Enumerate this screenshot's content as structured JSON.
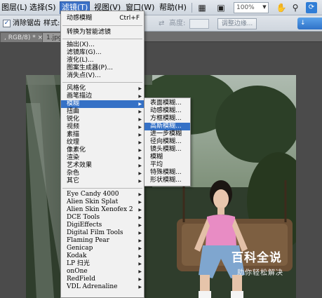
{
  "menubar": {
    "items": [
      {
        "label": "图层(L)"
      },
      {
        "label": "选择(S)"
      },
      {
        "label": "滤镜(T)"
      },
      {
        "label": "视图(V)"
      },
      {
        "label": "窗口(W)"
      },
      {
        "label": "帮助(H)"
      }
    ],
    "zoom": "100%"
  },
  "options": {
    "antialias_label": "消除锯齿",
    "style_label": "样式:",
    "height_label": "高度:",
    "refine_button": "调整边缘...",
    "go_button": "↓"
  },
  "tabs": [
    {
      "label": ", RGB/8) * ×"
    },
    {
      "label": "1.jpg"
    }
  ],
  "filter_menu": {
    "last_filter": "动感模糊",
    "last_filter_shortcut": "Ctrl+F",
    "smart_filter": "转换为智能滤镜",
    "items_a": [
      {
        "label": "抽出(X)..."
      },
      {
        "label": "滤镜库(G)..."
      },
      {
        "label": "液化(L)..."
      },
      {
        "label": "图案生成器(P)..."
      },
      {
        "label": "消失点(V)..."
      }
    ],
    "items_b": [
      {
        "label": "风格化"
      },
      {
        "label": "画笔描边"
      },
      {
        "label": "模糊"
      },
      {
        "label": "扭曲"
      },
      {
        "label": "锐化"
      },
      {
        "label": "视频"
      },
      {
        "label": "素描"
      },
      {
        "label": "纹理"
      },
      {
        "label": "像素化"
      },
      {
        "label": "渲染"
      },
      {
        "label": "艺术效果"
      },
      {
        "label": "杂色"
      },
      {
        "label": "其它"
      }
    ],
    "items_c": [
      {
        "label": "Eye Candy 4000"
      },
      {
        "label": "Alien Skin Splat"
      },
      {
        "label": "Alien Skin Xenofex 2"
      },
      {
        "label": "DCE Tools"
      },
      {
        "label": "DigiEffects"
      },
      {
        "label": "Digital Film Tools"
      },
      {
        "label": "Flaming Pear"
      },
      {
        "label": "Genicap"
      },
      {
        "label": "Kodak"
      },
      {
        "label": "LP 扫光"
      },
      {
        "label": "onOne"
      },
      {
        "label": "RedField"
      },
      {
        "label": "VDL Adrenaline"
      }
    ]
  },
  "blur_submenu": {
    "items": [
      {
        "label": "表面模糊..."
      },
      {
        "label": "动感模糊..."
      },
      {
        "label": "方框模糊..."
      },
      {
        "label": "高斯模糊..."
      },
      {
        "label": "进一步模糊"
      },
      {
        "label": "径向模糊..."
      },
      {
        "label": "镜头模糊..."
      },
      {
        "label": "模糊"
      },
      {
        "label": "平均"
      },
      {
        "label": "特殊模糊..."
      },
      {
        "label": "形状模糊..."
      }
    ]
  },
  "watermark": {
    "title": "百科全说",
    "subtitle": "助你轻松解决"
  },
  "colors": {
    "highlight": "#3571c6",
    "menu_bg": "#f1f1f1"
  }
}
